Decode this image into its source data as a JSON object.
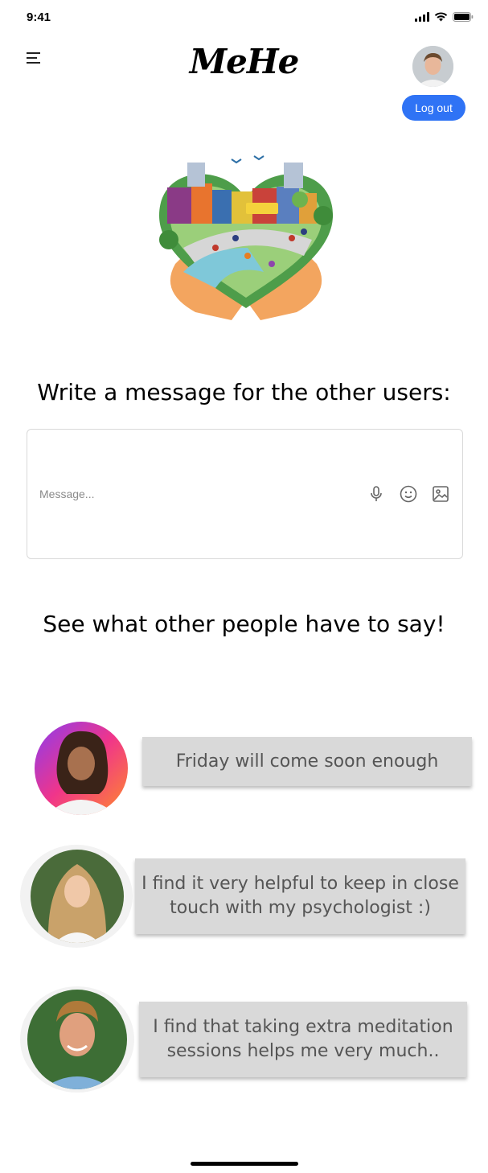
{
  "status": {
    "time": "9:41"
  },
  "header": {
    "logo": "MeHe",
    "logout_label": "Log out"
  },
  "compose": {
    "title": "Write a message for the other users:",
    "placeholder": "Message...",
    "tools": [
      "microphone-icon",
      "emoji-icon",
      "image-icon"
    ]
  },
  "feed": {
    "title": "See what other people have to say!",
    "posts": [
      {
        "text": "Friday will come soon enough"
      },
      {
        "text": "I find it very helpful to keep in close touch with my psychologist :)"
      },
      {
        "text": "I find that taking extra meditation sessions helps me very much.."
      }
    ]
  },
  "colors": {
    "accent": "#2f73f5",
    "bubble": "#d9d9d9",
    "bubble_text": "#555555"
  }
}
